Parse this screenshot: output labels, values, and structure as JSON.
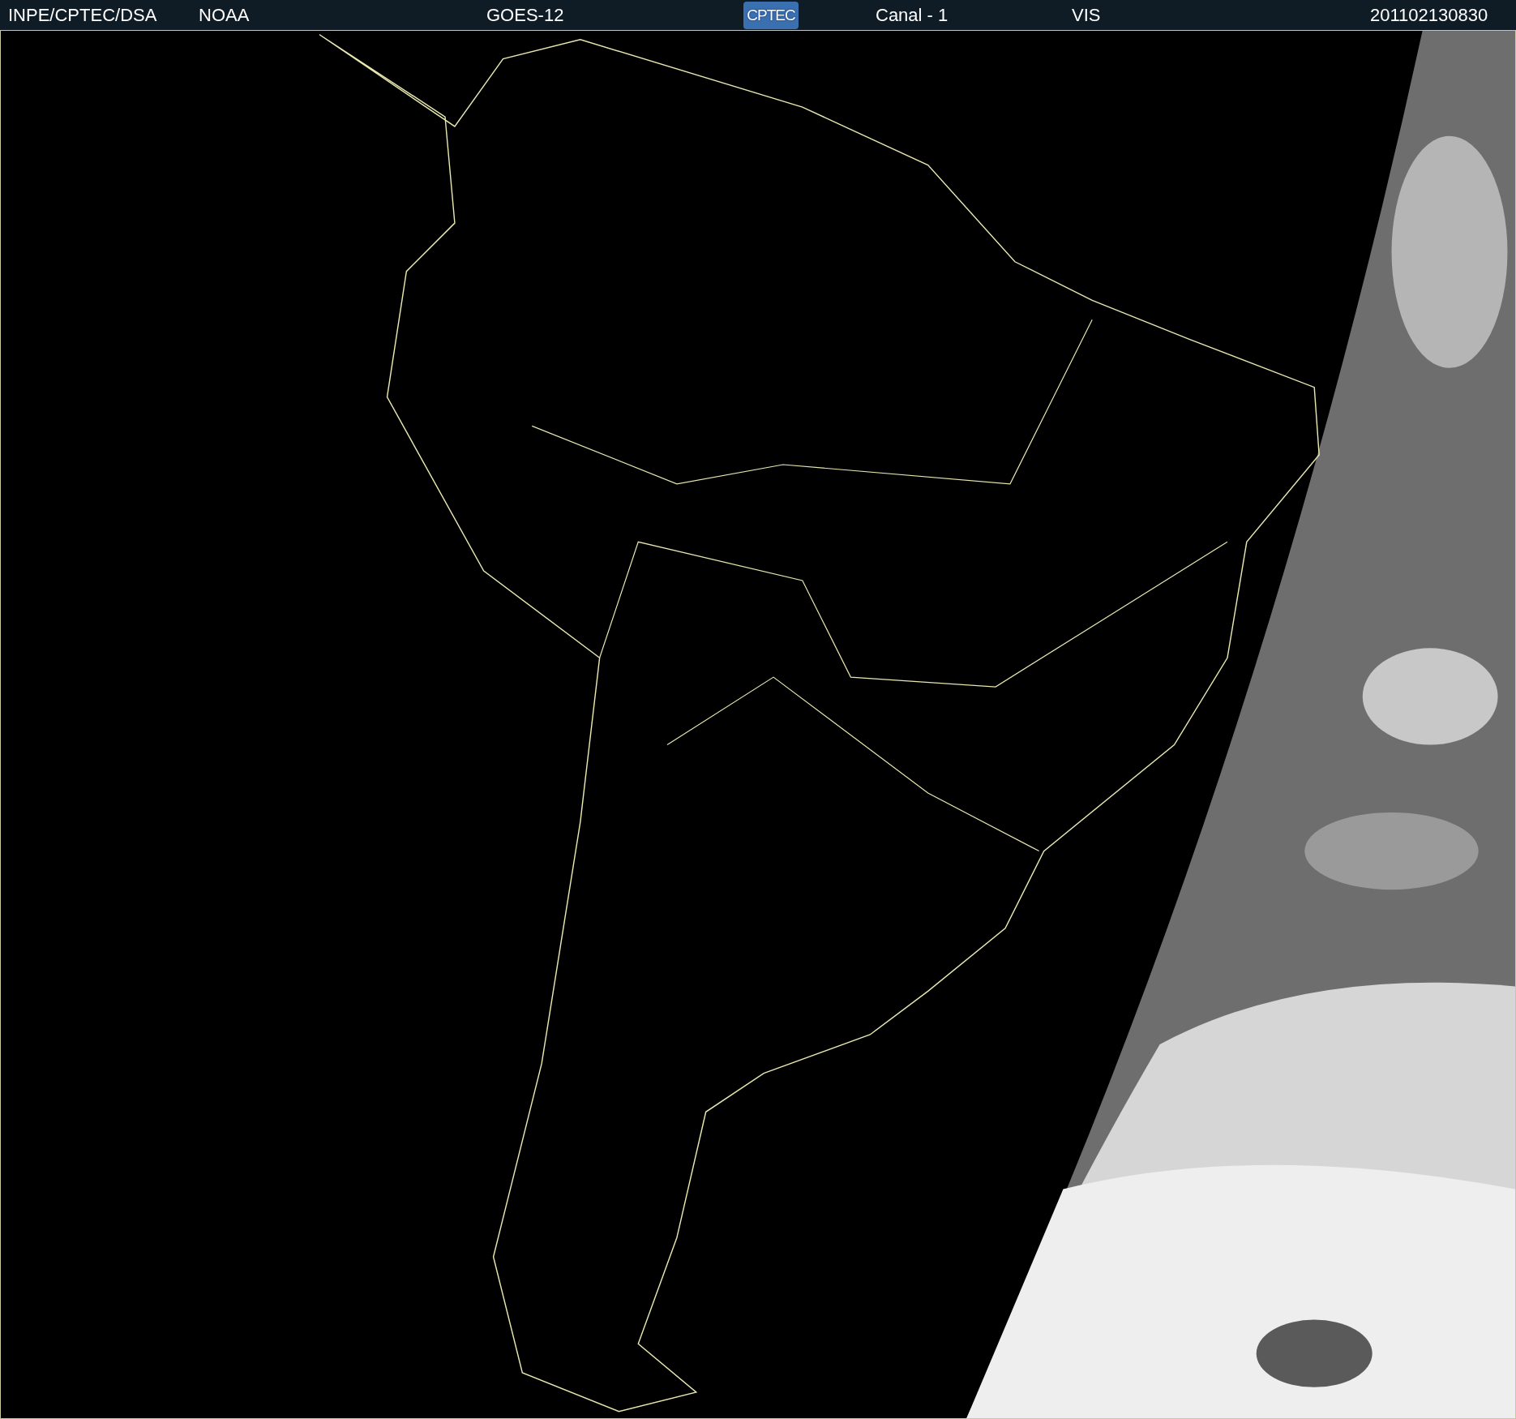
{
  "header": {
    "items": [
      {
        "kind": "text",
        "text": "INPE/CPTEC/DSA"
      },
      {
        "kind": "text",
        "text": "NOAA"
      },
      {
        "kind": "text",
        "text": "GOES-12"
      },
      {
        "kind": "logo",
        "text": "CPTEC"
      },
      {
        "kind": "text",
        "text": "Canal - 1"
      },
      {
        "kind": "text",
        "text": "VIS"
      },
      {
        "kind": "text",
        "text": "201102130830"
      }
    ]
  }
}
